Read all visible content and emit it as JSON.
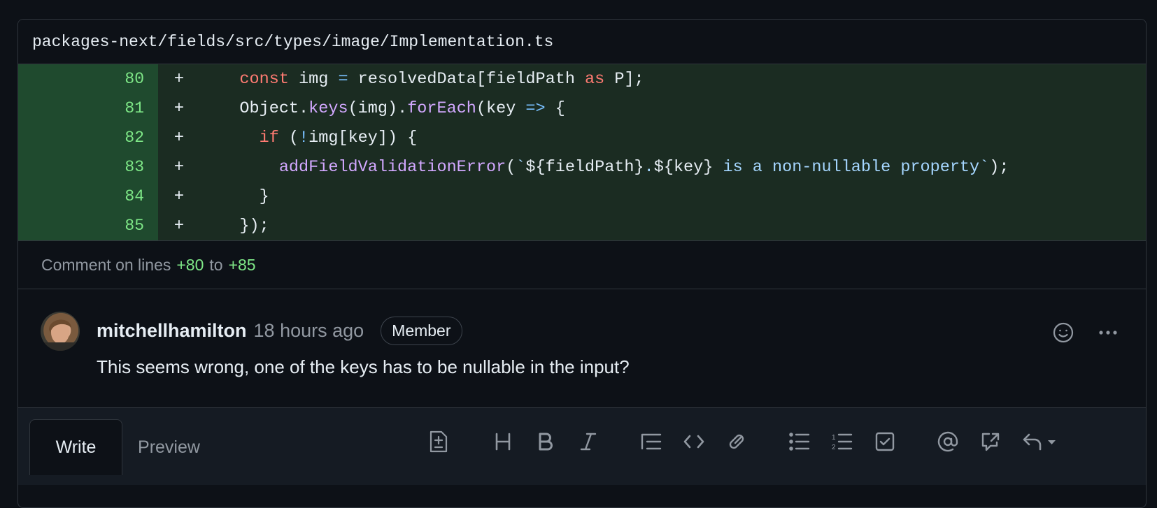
{
  "file": {
    "path": "packages-next/fields/src/types/image/Implementation.ts"
  },
  "diff": {
    "marker": "+",
    "lines": [
      {
        "num": "80"
      },
      {
        "num": "81"
      },
      {
        "num": "82"
      },
      {
        "num": "83"
      },
      {
        "num": "84"
      },
      {
        "num": "85"
      }
    ]
  },
  "comment_range": {
    "prefix": "Comment on lines",
    "start": "+80",
    "middle": "to",
    "end": "+85"
  },
  "comment": {
    "author": "mitchellhamilton",
    "time": "18 hours ago",
    "badge": "Member",
    "body": "This seems wrong, one of the keys has to be nullable in the input?"
  },
  "editor": {
    "tabs": [
      {
        "label": "Write",
        "active": true
      },
      {
        "label": "Preview",
        "active": false
      }
    ],
    "toolbar_icons": [
      "file-diff-icon",
      "heading-icon",
      "bold-icon",
      "italic-icon",
      "quote-icon",
      "code-icon",
      "link-icon",
      "unordered-list-icon",
      "ordered-list-icon",
      "task-list-icon",
      "mention-icon",
      "cross-reference-icon",
      "reply-icon"
    ]
  },
  "colors": {
    "background": "#0d1117",
    "addition_bg": "#1b2c22",
    "addition_num_bg": "#1f4a2e",
    "addition_fg": "#7ee787",
    "keyword": "#ff7b72",
    "function": "#d2a8ff",
    "string": "#a5d6ff",
    "muted": "#9198a1"
  }
}
